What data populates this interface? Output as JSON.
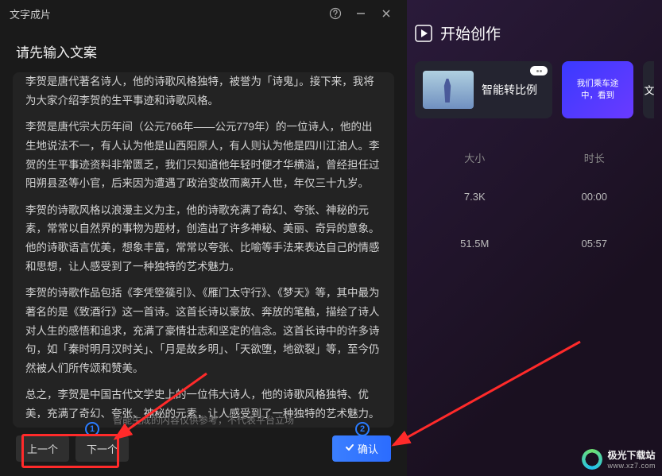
{
  "titlebar": {
    "title": "文字成片"
  },
  "prompt": {
    "header": "请先输入文案"
  },
  "body": {
    "p0": "李贺是唐代著名诗人，他的诗歌风格独特，被誉为「诗鬼」。接下来，我将为大家介绍李贺的生平事迹和诗歌风格。",
    "p1": "李贺是唐代宗大历年间（公元766年——公元779年）的一位诗人，他的出生地说法不一，有人认为他是山西阳原人，有人则认为他是四川江油人。李贺的生平事迹资料非常匮乏，我们只知道他年轻时便才华横溢，曾经担任过阳朔县丞等小官，后来因为遭遇了政治变故而离开人世，年仅三十九岁。",
    "p2": "李贺的诗歌风格以浪漫主义为主，他的诗歌充满了奇幻、夸张、神秘的元素，常常以自然界的事物为题材，创造出了许多神秘、美丽、奇异的意象。他的诗歌语言优美，想象丰富，常常以夸张、比喻等手法来表达自己的情感和思想，让人感受到了一种独特的艺术魅力。",
    "p3": "李贺的诗歌作品包括《李凭箜篌引》、《雁门太守行》、《梦天》等，其中最为著名的是《致酒行》这一首诗。这首长诗以豪放、奔放的笔触，描绘了诗人对人生的感悟和追求，充满了豪情壮志和坚定的信念。这首长诗中的许多诗句，如「秦时明月汉时关」、「月是故乡明」、「天欲堕，地欲裂」等，至今仍然被人们所传颂和赞美。",
    "p4": "总之，李贺是中国古代文学史上的一位伟大诗人，他的诗歌风格独特、优美，充满了奇幻、夸张、神秘的元素，让人感受到了一种独特的艺术魅力。他的生平事迹和诗歌作品，都值得我们深入研究和探讨。"
  },
  "footer": {
    "badge1": "1",
    "badge2": "2",
    "prev": "上一个",
    "next": "下一个",
    "disclaimer": "智能生成的内容仅供参考，不代表平台立场",
    "confirm": "确认"
  },
  "right": {
    "header": "开始创作",
    "card1": "智能转比例",
    "card2_small": "我们乘车途中，看到",
    "card2_big": "文",
    "th_size": "大小",
    "th_time": "时长",
    "rows": [
      {
        "size": "7.3K",
        "time": "00:00"
      },
      {
        "size": "51.5M",
        "time": "05:57"
      }
    ]
  },
  "logo": {
    "name": "极光下载站",
    "url": "www.xz7.com"
  }
}
